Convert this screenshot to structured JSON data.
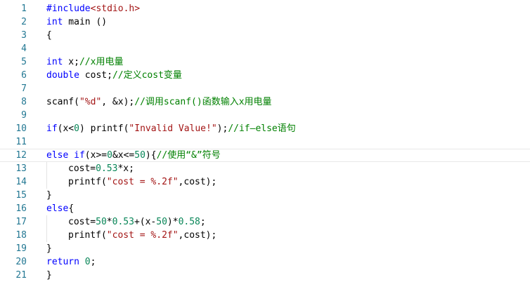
{
  "editor": {
    "lines": [
      {
        "n": "1",
        "t": "#include<stdio.h>"
      },
      {
        "n": "2",
        "t": "int main ()"
      },
      {
        "n": "3",
        "t": "{"
      },
      {
        "n": "4",
        "t": ""
      },
      {
        "n": "5",
        "t": "int x;//x用电量"
      },
      {
        "n": "6",
        "t": "double cost;//定义cost变量"
      },
      {
        "n": "7",
        "t": ""
      },
      {
        "n": "8",
        "t": "scanf(\"%d\", &x);//调用scanf()函数输入x用电量"
      },
      {
        "n": "9",
        "t": ""
      },
      {
        "n": "10",
        "t": "if(x<0) printf(\"Invalid Value!\");//if—else语句"
      },
      {
        "n": "11",
        "t": ""
      },
      {
        "n": "12",
        "t": "else if(x>=0&x<=50){//使用“&”符号"
      },
      {
        "n": "13",
        "t": "cost=0.53*x;"
      },
      {
        "n": "14",
        "t": "printf(\"cost = %.2f\",cost);"
      },
      {
        "n": "15",
        "t": "}"
      },
      {
        "n": "16",
        "t": "else{"
      },
      {
        "n": "17",
        "t": "cost=50*0.53+(x-50)*0.58;"
      },
      {
        "n": "18",
        "t": "printf(\"cost = %.2f\",cost);"
      },
      {
        "n": "19",
        "t": "}"
      },
      {
        "n": "20",
        "t": "return 0;"
      },
      {
        "n": "21",
        "t": "}"
      }
    ],
    "parts": {
      "l1_pp": "#include",
      "l1_str": "<stdio.h>",
      "l2_kw": "int",
      "l2_rest": " main ()",
      "l3": "{",
      "l5_kw": "int",
      "l5_rest": " x;",
      "l5_cmt": "//x用电量",
      "l6_kw": "double",
      "l6_rest": " cost;",
      "l6_cmt": "//定义cost变量",
      "l8_a": "scanf(",
      "l8_str": "\"%d\"",
      "l8_b": ", &x);",
      "l8_cmt": "//调用scanf()函数输入x用电量",
      "l10_kw": "if",
      "l10_a": "(x<",
      "l10_num": "0",
      "l10_b": ") printf(",
      "l10_str": "\"Invalid Value!\"",
      "l10_c": ");",
      "l10_cmt": "//if—else语句",
      "l12_kw1": "else",
      "l12_sp": " ",
      "l12_kw2": "if",
      "l12_a": "(x>=",
      "l12_num1": "0",
      "l12_b": "&x<=",
      "l12_num2": "50",
      "l12_c": "){",
      "l12_cmt": "//使用“&”符号",
      "l13_a": "cost=",
      "l13_num": "0.53",
      "l13_b": "*x;",
      "l14_a": "printf(",
      "l14_str": "\"cost = %.2f\"",
      "l14_b": ",cost);",
      "l15": "}",
      "l16_kw": "else",
      "l16_b": "{",
      "l17_a": "cost=",
      "l17_num1": "50",
      "l17_b": "*",
      "l17_num2": "0.53",
      "l17_c": "+(x-",
      "l17_num3": "50",
      "l17_d": ")*",
      "l17_num4": "0.58",
      "l17_e": ";",
      "l18_a": "printf(",
      "l18_str": "\"cost = %.2f\"",
      "l18_b": ",cost);",
      "l19": "}",
      "l20_kw": "return",
      "l20_sp": " ",
      "l20_num": "0",
      "l20_b": ";",
      "l21": "}"
    }
  }
}
